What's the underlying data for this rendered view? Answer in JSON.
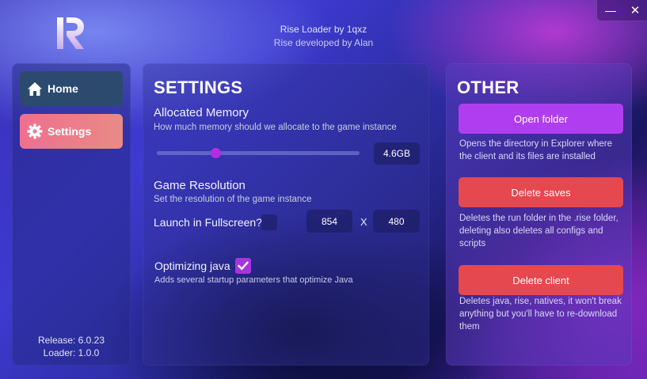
{
  "window": {
    "minimize_glyph": "—",
    "close_glyph": "✕"
  },
  "header": {
    "title": "Rise Loader by 1qxz",
    "subtitle": "Rise developed by Alan"
  },
  "sidebar": {
    "items": [
      {
        "label": "Home",
        "icon": "home-icon"
      },
      {
        "label": "Settings",
        "icon": "gear-icon",
        "active": true
      }
    ],
    "release_text": "Release: 6.0.23",
    "loader_text": "Loader: 1.0.0"
  },
  "settings": {
    "heading": "SETTINGS",
    "memory": {
      "title": "Allocated Memory",
      "description": "How much memory should we allocate to the game instance",
      "value": "4.6GB",
      "slider_fraction": 0.29
    },
    "resolution": {
      "title": "Game Resolution",
      "description": "Set the resolution of the game instance",
      "fullscreen_label": "Launch in Fullscreen?",
      "fullscreen_checked": false,
      "width": "854",
      "separator": "X",
      "height": "480"
    },
    "optimizing": {
      "label": "Optimizing java",
      "checked": true,
      "description": "Adds several startup parameters that optimize Java"
    }
  },
  "other": {
    "heading": "OTHER",
    "buttons": [
      {
        "label": "Open folder",
        "description": "Opens the directory in Explorer where the client and its files are installed"
      },
      {
        "label": "Delete saves",
        "description": "Deletes the run folder in the .rise folder, deleting also deletes all configs and scripts"
      },
      {
        "label": "Delete client",
        "description": "Deletes java, rise, natives, it won't break anything but you'll have to re-download them"
      }
    ]
  },
  "colors": {
    "accent_purple": "#b03ef0",
    "danger_red": "#e5484e",
    "nav_active": "#ee6f8f",
    "nav_inactive": "#2b4a6e"
  }
}
